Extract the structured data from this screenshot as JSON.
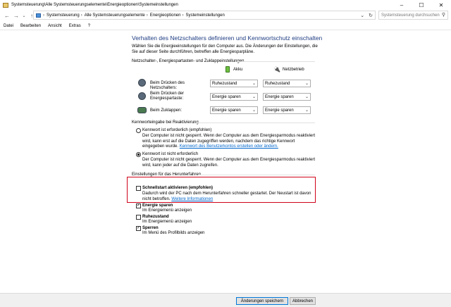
{
  "window": {
    "title": "Systemsteuerung\\Alle Systemsteuerungselemente\\Energieoptionen\\Systemeinstellungen",
    "minimize": "–",
    "maximize": "☐",
    "close": "✕"
  },
  "addressbar": {
    "back": "←",
    "forward": "→",
    "recent": "⌄",
    "up": "↑",
    "crumbs": [
      "Systemsteuerung",
      "Alle Systemsteuerungselemente",
      "Energieoptionen",
      "Systemeinstellungen"
    ],
    "separator": "›",
    "dropdown": "⌄",
    "refresh": "↻",
    "search_placeholder": "Systemsteuerung durchsuchen",
    "search_icon": "⚲"
  },
  "menu": [
    "Datei",
    "Bearbeiten",
    "Ansicht",
    "Extras",
    "?"
  ],
  "main": {
    "heading": "Verhalten des Netzschalters definieren und Kennwortschutz einschalten",
    "description": "Wählen Sie die Energieeinstellungen für den Computer aus. Die Änderungen der Einstellungen, die Sie auf dieser Seite durchführen, betreffen alle Energiesparpläne.",
    "buttons_group_label": "Netzschalter-, Energiespartasten- und Zuklappeinstellungen",
    "col_battery": "Akku",
    "col_ac": "Netzbetrieb",
    "rows": [
      {
        "label": "Beim Drücken des Netzschalters:",
        "battery": "Ruhezustand",
        "ac": "Ruhezustand"
      },
      {
        "label": "Beim Drücken der Energiespartaste:",
        "battery": "Energie sparen",
        "ac": "Energie sparen"
      },
      {
        "label": "Beim Zuklappen:",
        "battery": "Energie sparen",
        "ac": "Energie sparen"
      }
    ],
    "password_group_label": "Kennworteingabe bei Reaktivierung",
    "password_required": {
      "title": "Kennwort ist erforderlich (empfohlen)",
      "desc": "Der Computer ist nicht gesperrt. Wenn der Computer aus dem Energiesparmodus reaktiviert wird, kann erst auf die Daten zugegriffen werden, nachdem das richtige Kennwort eingegeben wurde.",
      "link": "Kennwort des Benutzerkontos erstellen oder ändern."
    },
    "password_not_required": {
      "title": "Kennwort ist nicht erforderlich",
      "desc": "Der Computer ist nicht gesperrt. Wenn der Computer aus dem Energiesparmodus reaktiviert wird, kann jeder auf die Daten zugreifen."
    },
    "shutdown_group_label": "Einstellungen für das Herunterfahren",
    "fast_startup": {
      "title": "Schnellstart aktivieren (empfohlen)",
      "desc": "Dadurch wird der PC nach dem Herunterfahren schneller gestartet. Der Neustart ist davon nicht betroffen.",
      "link": "Weitere Informationen"
    },
    "sleep_option": {
      "title": "Energie sparen",
      "desc": "Im Energiemenü anzeigen"
    },
    "hibernate_option": {
      "title": "Ruhezustand",
      "desc": "Im Energiemenü anzeigen"
    },
    "lock_option": {
      "title": "Sperren",
      "desc": "Im Menü des Profilbilds anzeigen"
    }
  },
  "footer": {
    "save": "Änderungen speichern",
    "cancel": "Abbrechen"
  },
  "colors": {
    "heading": "#1e3c82",
    "link": "#0066cc",
    "highlight_box": "#d0021b"
  },
  "select_arrow": "⌄"
}
